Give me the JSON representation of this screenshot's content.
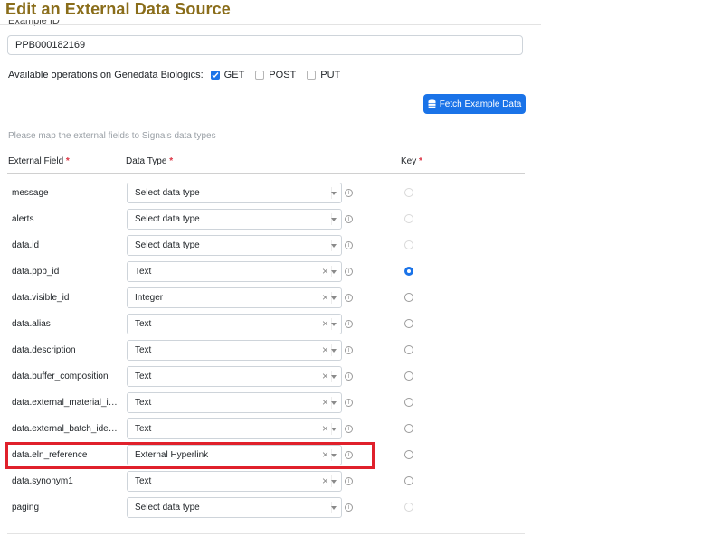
{
  "page": {
    "title": "Edit an External Data Source"
  },
  "example": {
    "label": "Example ID",
    "value": "PPB000182169"
  },
  "operations": {
    "label": "Available operations on Genedata Biologics:",
    "items": [
      {
        "label": "GET",
        "checked": true
      },
      {
        "label": "POST",
        "checked": false
      },
      {
        "label": "PUT",
        "checked": false
      }
    ]
  },
  "fetch_button": {
    "label": "Fetch Example Data",
    "icon": "database-icon"
  },
  "mapping": {
    "hint": "Please map the external fields to Signals data types",
    "headers": {
      "field": "External Field",
      "type": "Data Type",
      "key": "Key",
      "required_mark": "*"
    },
    "rows": [
      {
        "field": "message",
        "type": "Select data type",
        "placeholder": true,
        "key": "disabled"
      },
      {
        "field": "alerts",
        "type": "Select data type",
        "placeholder": true,
        "key": "disabled"
      },
      {
        "field": "data.id",
        "type": "Select data type",
        "placeholder": true,
        "key": "disabled"
      },
      {
        "field": "data.ppb_id",
        "type": "Text",
        "placeholder": false,
        "key": "checked"
      },
      {
        "field": "data.visible_id",
        "type": "Integer",
        "placeholder": false,
        "key": "unchecked"
      },
      {
        "field": "data.alias",
        "type": "Text",
        "placeholder": false,
        "key": "unchecked"
      },
      {
        "field": "data.description",
        "type": "Text",
        "placeholder": false,
        "key": "unchecked"
      },
      {
        "field": "data.buffer_composition",
        "type": "Text",
        "placeholder": false,
        "key": "unchecked"
      },
      {
        "field": "data.external_material_ide...",
        "type": "Text",
        "placeholder": false,
        "key": "unchecked"
      },
      {
        "field": "data.external_batch_identi...",
        "type": "Text",
        "placeholder": false,
        "key": "unchecked"
      },
      {
        "field": "data.eln_reference",
        "type": "External Hyperlink",
        "placeholder": false,
        "key": "unchecked"
      },
      {
        "field": "data.synonym1",
        "type": "Text",
        "placeholder": false,
        "key": "unchecked"
      },
      {
        "field": "paging",
        "type": "Select data type",
        "placeholder": true,
        "key": "disabled"
      }
    ]
  },
  "colors": {
    "accent": "#1a73e8",
    "title": "#8a6d1a",
    "required": "#dc3545",
    "highlight": "#e0202b"
  }
}
